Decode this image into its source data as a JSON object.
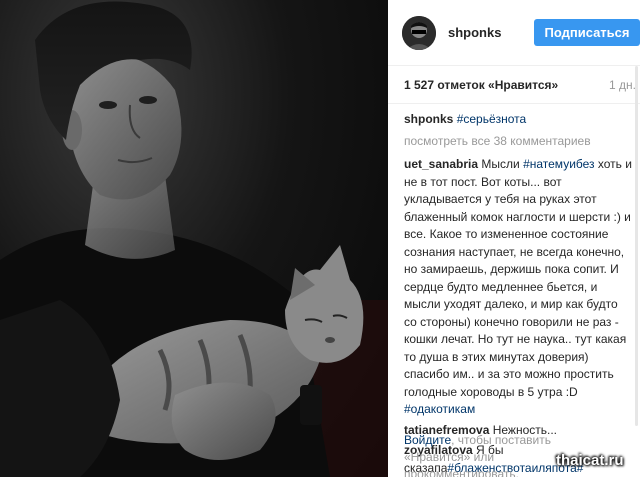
{
  "post": {
    "username": "shponks",
    "follow_label": "Подписаться",
    "likes_text": "1 527 отметок «Нравится»",
    "time_text": "1 дн.",
    "caption": {
      "author": "shponks",
      "tag": "#серьёзнота"
    },
    "view_all_comments": "посмотреть все 38 комментариев",
    "comments": [
      {
        "author": "uet_sanabria",
        "parts": [
          {
            "text": "Мысли "
          },
          {
            "text": "#натемуибез",
            "tag": true
          },
          {
            "text": " хоть и не в тот пост. Вот коты... вот укладывается у тебя на руках этот блаженный комок наглости и шерсти :) и все. Какое то измененное состояние сознания наступает, не всегда конечно, но замираешь, держишь пока сопит. И сердце будто медленнее бьется, и мысли уходят далеко, и мир как будто со стороны) конечно говорили не раз - кошки лечат. Но тут не наука.. тут какая то душа в этих минутах доверия) спасибо им.. и за это можно простить голодные хороводы в 5 утра :D "
          },
          {
            "text": "#одакотикам",
            "tag": true
          }
        ]
      },
      {
        "author": "tatianefremova",
        "parts": [
          {
            "text": " Нежность..."
          }
        ]
      },
      {
        "author": "zoyafilatova",
        "parts": [
          {
            "text": " Я бы сказапа"
          },
          {
            "text": "#блаженствотаиляпота",
            "tag": true
          },
          {
            "text": "#",
            "tag": true
          }
        ]
      }
    ],
    "login_prompt": {
      "link": "Войдите",
      "text": ", чтобы поставить «Нравится» или прокомментировать."
    }
  },
  "watermark": "thaicat.ru",
  "colors": {
    "follow_button": "#3897f0",
    "hashtag": "#003569",
    "muted": "#999999",
    "text": "#262626"
  }
}
